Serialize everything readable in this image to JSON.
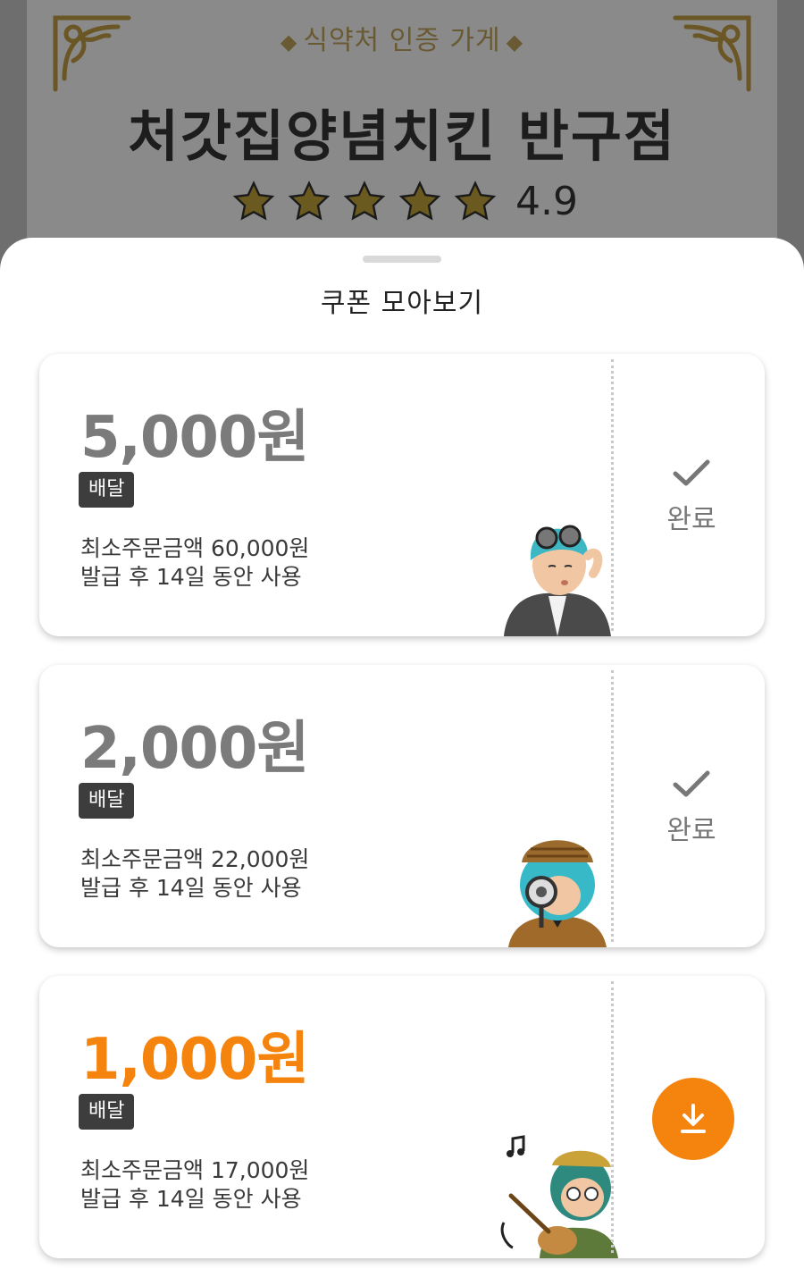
{
  "store": {
    "badge": "식약처 인증 가게",
    "name": "처갓집양념치킨 반구점",
    "rating": "4.9",
    "star_count": 5
  },
  "sheet": {
    "title": "쿠폰 모아보기"
  },
  "coupons": [
    {
      "amount": "5,000원",
      "tag": "배달",
      "min_order": "최소주문금액 60,000원",
      "validity": "발급 후 14일 동안 사용",
      "status": "완료",
      "state": "done",
      "mascot": "goggles-character"
    },
    {
      "amount": "2,000원",
      "tag": "배달",
      "min_order": "최소주문금액 22,000원",
      "validity": "발급 후 14일 동안 사용",
      "status": "완료",
      "state": "done",
      "mascot": "detective-character"
    },
    {
      "amount": "1,000원",
      "tag": "배달",
      "min_order": "최소주문금액 17,000원",
      "validity": "발급 후 14일 동안 사용",
      "status": "download",
      "state": "available",
      "mascot": "guitar-character"
    }
  ],
  "colors": {
    "accent": "#f5840e",
    "used_amount": "#7b7b7b",
    "tag_bg": "#3d3d3d",
    "dim_overlay": "#6e6e6e"
  },
  "icons": {
    "check": "check-icon",
    "download": "download-icon",
    "star": "star-icon",
    "ornament": "ornament-icon"
  }
}
